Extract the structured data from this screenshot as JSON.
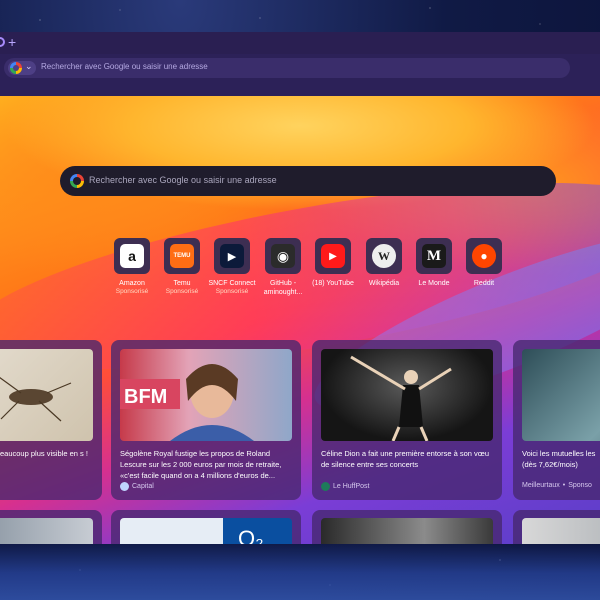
{
  "browser": {
    "new_tab_symbol": "+",
    "address_placeholder": "Rechercher avec Google ou saisir une adresse"
  },
  "newtab": {
    "search_placeholder": "Rechercher avec Google ou saisir une adresse",
    "speed_dials": [
      {
        "label": "Amazon",
        "sub": "Sponsorisé",
        "glyph": "a",
        "icon": "amazon-icon"
      },
      {
        "label": "Temu",
        "sub": "Sponsorisé",
        "glyph": "TEMU",
        "icon": "temu-icon"
      },
      {
        "label": "SNCF Connect",
        "sub": "Sponsorisé",
        "glyph": "▶",
        "icon": "sncf-connect-icon"
      },
      {
        "label": "GitHub - aminought...",
        "sub": "",
        "glyph": "◉",
        "icon": "github-icon"
      },
      {
        "label": "(18) YouTube",
        "sub": "",
        "glyph": "▶",
        "icon": "youtube-icon"
      },
      {
        "label": "Wikipédia",
        "sub": "",
        "glyph": "W",
        "icon": "wikipedia-icon"
      },
      {
        "label": "Le Monde",
        "sub": "",
        "glyph": "M",
        "icon": "le-monde-icon"
      },
      {
        "label": "Reddit",
        "sub": "",
        "glyph": "●",
        "icon": "reddit-icon"
      }
    ],
    "stories": [
      {
        "title": "eaucoup plus visible en s !",
        "source": "",
        "time": ""
      },
      {
        "title": "Ségolène Royal fustige les propos de Roland Lescure sur les 2 000 euros par mois de retraite, «c'est facile quand on a 4 millions d'euros de...",
        "source": "Capital",
        "time": ""
      },
      {
        "title": "Céline Dion a fait une première entorse à son vœu de silence entre ses concerts",
        "source": "Le HuffPost",
        "time": ""
      },
      {
        "title": "Voici les mutuelles les (dès 7,62€/mois)",
        "source": "Meilleurtaux",
        "time": "Sponso"
      }
    ]
  },
  "colors": {
    "accent": "#a78bfa",
    "searchbar": "#1f1c2c",
    "card_bg": "#46286e"
  }
}
